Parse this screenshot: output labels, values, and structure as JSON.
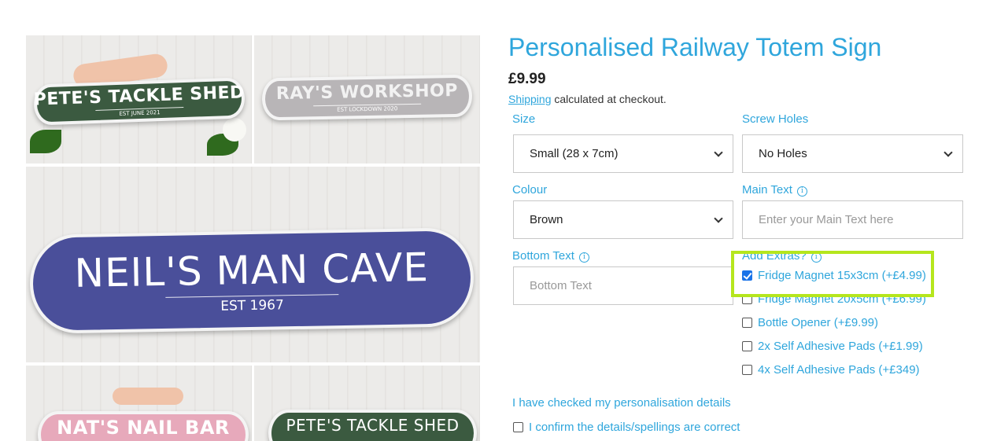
{
  "gallery": {
    "signs": [
      {
        "name": "PETE'S TACKLE SHED",
        "est": "EST JUNE 2021"
      },
      {
        "name": "RAY'S WORKSHOP",
        "est": "EST LOCKDOWN 2020"
      },
      {
        "name": "NEIL'S MAN CAVE",
        "est": "EST 1967"
      },
      {
        "name": "NAT'S NAIL BAR",
        "est": ""
      },
      {
        "name": "PETE'S TACKLE SHED",
        "est": ""
      }
    ]
  },
  "product": {
    "title": "Personalised Railway Totem Sign",
    "price": "£9.99",
    "shipping_link": "Shipping",
    "shipping_text": " calculated at checkout."
  },
  "options": {
    "size": {
      "label": "Size",
      "value": "Small (28 x 7cm)"
    },
    "screw_holes": {
      "label": "Screw Holes",
      "value": "No Holes"
    },
    "colour": {
      "label": "Colour",
      "value": "Brown"
    },
    "main_text": {
      "label": "Main Text",
      "placeholder": "Enter your Main Text here"
    },
    "bottom_text": {
      "label": "Bottom Text",
      "placeholder": "Bottom Text"
    }
  },
  "extras": {
    "label": "Add Extras?",
    "items": [
      {
        "label": "Fridge Magnet 15x3cm (+£4.99)",
        "checked": true
      },
      {
        "label": "Fridge Magnet 20x5cm (+£6.99)",
        "checked": false
      },
      {
        "label": "Bottle Opener (+£9.99)",
        "checked": false
      },
      {
        "label": "2x Self Adhesive Pads (+£1.99)",
        "checked": false
      },
      {
        "label": "4x Self Adhesive Pads (+£349)",
        "checked": false
      }
    ]
  },
  "confirmation": {
    "heading": "I have checked my personalisation details",
    "checkbox_label": "I confirm the details/spellings are correct",
    "checked": false
  },
  "colors": {
    "accent": "#2fa6dc",
    "highlight": "#b5e61d",
    "checkbox_on": "#1a73e8"
  }
}
